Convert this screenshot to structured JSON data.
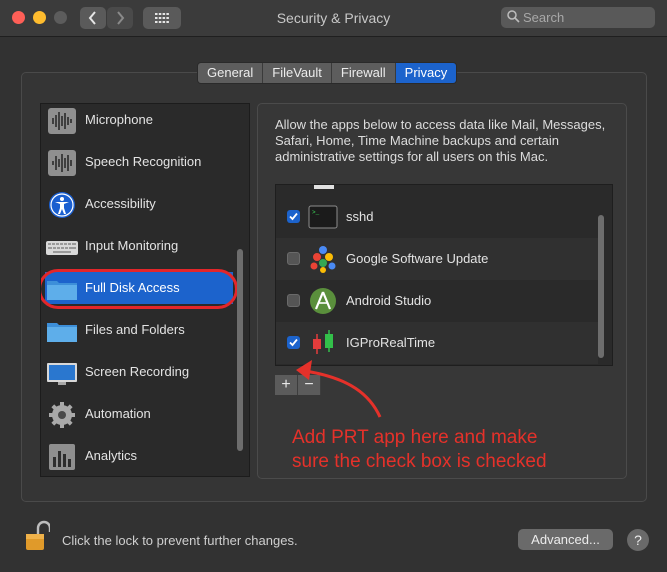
{
  "window": {
    "title": "Security & Privacy",
    "search_placeholder": "Search"
  },
  "tabs": [
    {
      "label": "General",
      "active": false
    },
    {
      "label": "FileVault",
      "active": false
    },
    {
      "label": "Firewall",
      "active": false
    },
    {
      "label": "Privacy",
      "active": true
    }
  ],
  "sidebar": {
    "items": [
      {
        "label": "Microphone",
        "icon": "microphone-waveform-icon"
      },
      {
        "label": "Speech Recognition",
        "icon": "speech-waveform-icon"
      },
      {
        "label": "Accessibility",
        "icon": "accessibility-person-icon"
      },
      {
        "label": "Input Monitoring",
        "icon": "keyboard-icon"
      },
      {
        "label": "Full Disk Access",
        "icon": "folder-icon",
        "selected": true
      },
      {
        "label": "Files and Folders",
        "icon": "folder-icon"
      },
      {
        "label": "Screen Recording",
        "icon": "monitor-icon"
      },
      {
        "label": "Automation",
        "icon": "gear-icon"
      },
      {
        "label": "Analytics",
        "icon": "bar-chart-icon"
      }
    ]
  },
  "description": "Allow the apps below to access data like Mail, Messages, Safari, Home, Time Machine backups and certain administrative settings for all users on this Mac.",
  "apps": [
    {
      "name": "sshd",
      "checked": true,
      "icon": "terminal-icon"
    },
    {
      "name": "Google Software Update",
      "checked": false,
      "icon": "google-update-balls-icon"
    },
    {
      "name": "Android Studio",
      "checked": false,
      "icon": "android-studio-icon"
    },
    {
      "name": "IGProRealTime",
      "checked": true,
      "icon": "candlestick-chart-icon"
    }
  ],
  "list_controls": {
    "add": "+",
    "remove": "−"
  },
  "annotation": {
    "line1": "Add PRT app here and make",
    "line2": "sure the check box is checked",
    "color": "#e5312a"
  },
  "footer": {
    "lock_text": "Click the lock to prevent further changes.",
    "advanced_label": "Advanced...",
    "help_label": "?"
  },
  "colors": {
    "accent": "#1c63cc",
    "highlight_ring": "#e3262a"
  }
}
